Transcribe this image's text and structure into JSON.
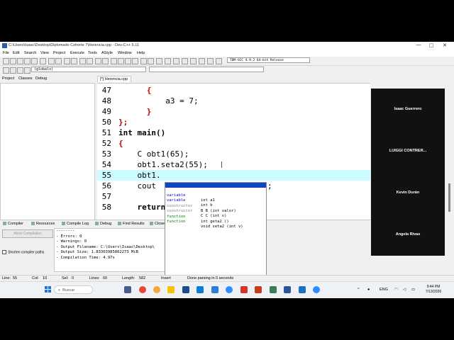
{
  "window": {
    "title": "C:\\Users\\Isaac\\Desktop\\Diplomado Cohorte 7\\Herencia.cpp - Dev-C++ 5.11",
    "minimize": "—",
    "maximize": "▢",
    "close": "✕"
  },
  "menu": [
    "File",
    "Edit",
    "Search",
    "View",
    "Project",
    "Execute",
    "Tools",
    "AStyle",
    "Window",
    "Help"
  ],
  "toolbar": {
    "compiler": "TDM-GCC 4.9.2 64-bit Release",
    "scope": "(globals)"
  },
  "left_tabs": [
    "Project",
    "Classes",
    "Debug"
  ],
  "editor_tab": "[*] Herencia.cpp",
  "code_lines": [
    {
      "n": "47",
      "text": "      {"
    },
    {
      "n": "48",
      "text": "          a3 = 7;"
    },
    {
      "n": "49",
      "text": "      }"
    },
    {
      "n": "50",
      "text": "};"
    },
    {
      "n": "51",
      "text": "int main()"
    },
    {
      "n": "52",
      "text": "{"
    },
    {
      "n": "53",
      "text": "    C obt1(65);"
    },
    {
      "n": "54",
      "text": "    obt1.seta2(55);"
    },
    {
      "n": "55",
      "text": "    obt1."
    },
    {
      "n": "56",
      "text": "    cout"
    },
    {
      "n": "57",
      "text": ""
    },
    {
      "n": "58",
      "text": "    return"
    }
  ],
  "code_tail": ";",
  "autocomplete": [
    {
      "kind": "constructor",
      "text": "A A (int valor)"
    },
    {
      "kind": "variable",
      "text": "int a1"
    },
    {
      "kind": "variable",
      "text": "int b"
    },
    {
      "kind": "constructor",
      "text": "B B (int valor)"
    },
    {
      "kind": "constructor",
      "text": "C C (int v)"
    },
    {
      "kind": "function",
      "text": "int geta2 ()"
    },
    {
      "kind": "function",
      "text": "void seta2 (int v)"
    }
  ],
  "participants": [
    "Isaac Guerrero",
    "LUIGGI  CONTRER...",
    "Kevin Durán",
    "Angela Rivas"
  ],
  "bottom_tabs": [
    "Compiler",
    "Resources",
    "Compile Log",
    "Debug",
    "Find Results",
    "Close"
  ],
  "abort_label": "Abort Compilation",
  "shorten_label": "Shorten compiler paths",
  "compile_log": [
    "--------",
    "- Errors: 0",
    "- Warnings: 0",
    "- Output Filename: C:\\Users\\Isaac\\Desktop\\",
    "- Output Size: 1.83303985862273 MiB",
    "- Compilation Time: 4.97s"
  ],
  "status": {
    "line_label": "Line:",
    "line": "55",
    "col_label": "Col:",
    "col": "10",
    "sel_label": "Sel:",
    "sel": "0",
    "lines_label": "Lines:",
    "lines": "60",
    "length_label": "Length:",
    "length": "582",
    "mode": "Insert",
    "message": "Done parsing in 0 seconds"
  },
  "taskbar": {
    "search": "Buscar",
    "search_glyph": "⌕",
    "language": "ENG",
    "time": "9:44 PM",
    "date": "7/13/2026"
  },
  "colors": {
    "current_line": "#ccfcff",
    "brace": "#c00000",
    "number": "#800080",
    "ac_selected": "#0a46c8"
  }
}
